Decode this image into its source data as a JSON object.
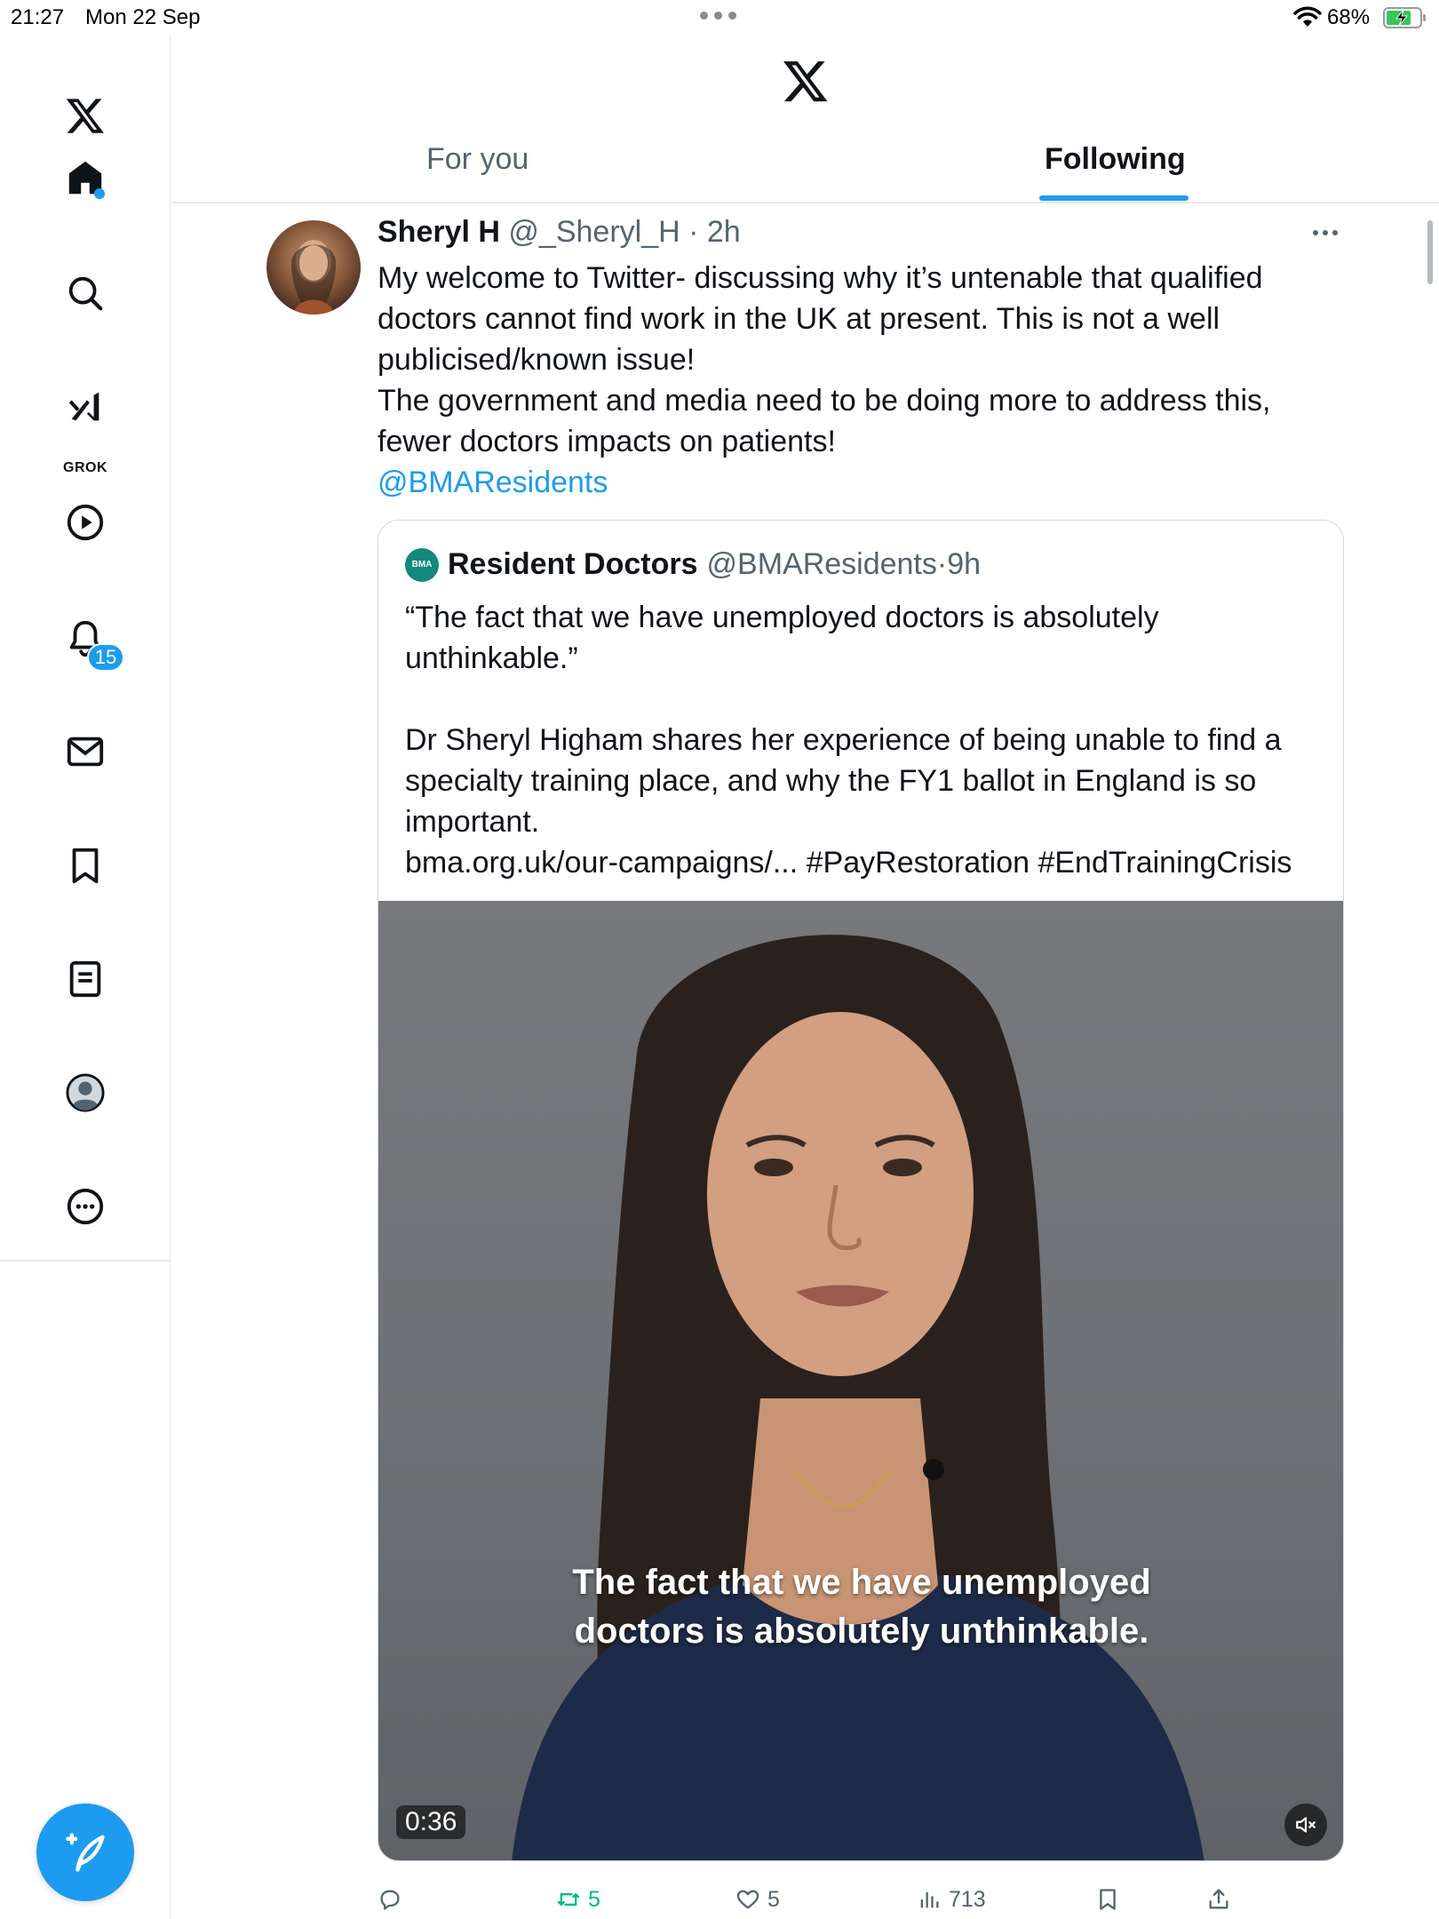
{
  "status_bar": {
    "time": "21:27",
    "date": "Mon 22 Sep",
    "battery": "68%"
  },
  "sidebar": {
    "items": [
      {
        "icon": "home-icon"
      },
      {
        "icon": "search-icon"
      },
      {
        "icon": "grok-icon",
        "label": "GROK"
      },
      {
        "icon": "video-icon"
      },
      {
        "icon": "notifications-icon",
        "badge": "15"
      },
      {
        "icon": "messages-icon"
      },
      {
        "icon": "bookmarks-icon"
      },
      {
        "icon": "lists-icon"
      },
      {
        "icon": "profile-icon"
      },
      {
        "icon": "more-icon"
      }
    ],
    "compose_icon": "compose-icon"
  },
  "header": {
    "tabs": [
      {
        "label": "For you"
      },
      {
        "label": "Following",
        "active": true
      }
    ]
  },
  "tweet": {
    "author_name": "Sheryl H",
    "handle": "@_Sheryl_H",
    "time": "2h",
    "lines": [
      "My welcome to Twitter- discussing why it’s untenable that qualified",
      "doctors cannot find work in the UK at present. This is not a well",
      "publicised/known issue!",
      "The government and media need to be doing more to address this,",
      "fewer doctors impacts on patients!"
    ],
    "mention": "@BMAResidents",
    "quote": {
      "logo_text": "BMA",
      "author_name": "Resident Doctors",
      "handle": "@BMAResidents",
      "time": "9h",
      "lines": [
        "“The fact that we have unemployed doctors is absolutely",
        "unthinkable.”",
        "",
        "Dr Sheryl Higham shares her experience of being unable to find a",
        "specialty training place, and why the FY1 ballot in England is so",
        "important.",
        "bma.org.uk/our-campaigns/... #PayRestoration #EndTrainingCrisis"
      ],
      "video": {
        "caption_line1": "The fact that we have unemployed",
        "caption_line2": "doctors is absolutely unthinkable.",
        "duration": "0:36"
      }
    },
    "actions": {
      "replies": "",
      "retweets": "5",
      "likes": "5",
      "views": "713"
    }
  },
  "colors": {
    "accent": "#1d9bf0",
    "retweet": "#00ba7c",
    "secondary_text": "#536471",
    "bma_green": "#12897b"
  }
}
